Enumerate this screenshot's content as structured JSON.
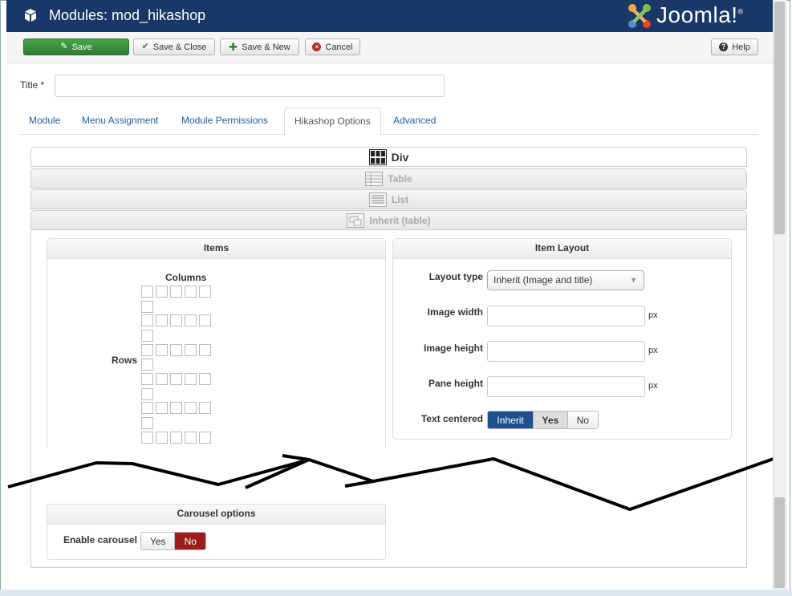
{
  "header": {
    "title": "Modules: mod_hikashop",
    "logo_text": "Joomla!",
    "logo_reg": "®",
    "colors": {
      "bar": "#1a3867"
    }
  },
  "toolbar": {
    "save_label": "Save",
    "save_close_label": "Save & Close",
    "save_new_label": "Save & New",
    "cancel_label": "Cancel",
    "help_label": "Help"
  },
  "form": {
    "title_label": "Title *",
    "title_value": ""
  },
  "tabs": [
    {
      "label": "Module"
    },
    {
      "label": "Menu Assignment"
    },
    {
      "label": "Module Permissions"
    },
    {
      "label": "Hikashop Options",
      "active": true
    },
    {
      "label": "Advanced"
    }
  ],
  "display_modes": [
    {
      "label": "Div",
      "active": true
    },
    {
      "label": "Table"
    },
    {
      "label": "List"
    },
    {
      "label": "Inherit (table)"
    }
  ],
  "items_panel": {
    "title": "Items",
    "columns_label": "Columns",
    "rows_label": "Rows"
  },
  "item_layout": {
    "title": "Item Layout",
    "layout_type_label": "Layout type",
    "layout_type_value": "Inherit (Image and title)",
    "image_width_label": "Image width",
    "image_height_label": "Image height",
    "pane_height_label": "Pane height",
    "unit": "px",
    "text_centered_label": "Text centered",
    "text_centered_options": [
      "Inherit",
      "Yes",
      "No"
    ]
  },
  "carousel": {
    "title": "Carousel options",
    "enable_label": "Enable carousel",
    "options": [
      "Yes",
      "No"
    ]
  }
}
